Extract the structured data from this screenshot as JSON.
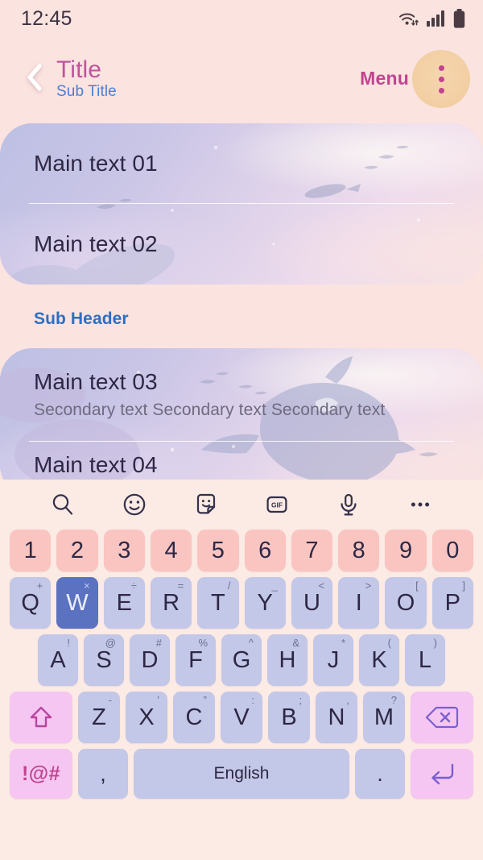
{
  "colors": {
    "page_background": "#fbe3e0",
    "title": "#c0539c",
    "subtitle": "#4a7fd4",
    "sub_header": "#2d6fc4",
    "menu_label": "#c0448f",
    "more_circle": "#f3cfa4",
    "keyboard_background": "#fceae4",
    "number_key": "#fac5c1",
    "letter_key": "#c3c7e8",
    "pressed_key": "#5b72c0",
    "function_key_pink": "#f6c6f2",
    "main_text": "#2e2744",
    "secondary_text": "#6f6a80"
  },
  "status_bar": {
    "time": "12:45",
    "icons": [
      "wifi-icon",
      "signal-icon",
      "battery-icon"
    ]
  },
  "app_bar": {
    "back_icon": "chevron-left-icon",
    "title": "Title",
    "subtitle": "Sub Title",
    "menu_label": "Menu",
    "more_icon": "more-vertical-icon"
  },
  "content": {
    "card_a": {
      "rows": [
        {
          "main": "Main text 01"
        },
        {
          "main": "Main text 02"
        }
      ]
    },
    "sub_header": "Sub Header",
    "card_b": {
      "rows": [
        {
          "main": "Main text 03",
          "secondary": "Secondary text Secondary text Secondary text"
        },
        {
          "main": "Main text 04"
        }
      ]
    }
  },
  "keyboard": {
    "toolbar": [
      {
        "name": "search-icon",
        "label": "search"
      },
      {
        "name": "emoji-icon",
        "label": "emoji"
      },
      {
        "name": "sticker-icon",
        "label": "sticker"
      },
      {
        "name": "gif-icon",
        "label": "GIF"
      },
      {
        "name": "mic-icon",
        "label": "voice"
      },
      {
        "name": "more-icon",
        "label": "more"
      }
    ],
    "number_row": [
      "1",
      "2",
      "3",
      "4",
      "5",
      "6",
      "7",
      "8",
      "9",
      "0"
    ],
    "row1": [
      {
        "key": "Q",
        "sup": "+"
      },
      {
        "key": "W",
        "sup": "×",
        "pressed": true
      },
      {
        "key": "E",
        "sup": "÷"
      },
      {
        "key": "R",
        "sup": "="
      },
      {
        "key": "T",
        "sup": "/"
      },
      {
        "key": "Y",
        "sup": "_"
      },
      {
        "key": "U",
        "sup": "<"
      },
      {
        "key": "I",
        "sup": ">"
      },
      {
        "key": "O",
        "sup": "["
      },
      {
        "key": "P",
        "sup": "]"
      }
    ],
    "row2": [
      {
        "key": "A",
        "sup": "!"
      },
      {
        "key": "S",
        "sup": "@"
      },
      {
        "key": "D",
        "sup": "#"
      },
      {
        "key": "F",
        "sup": "%"
      },
      {
        "key": "G",
        "sup": "^"
      },
      {
        "key": "H",
        "sup": "&"
      },
      {
        "key": "J",
        "sup": "*"
      },
      {
        "key": "K",
        "sup": "("
      },
      {
        "key": "L",
        "sup": ")"
      }
    ],
    "row3": {
      "shift_icon": "shift-up-arrow-icon",
      "keys": [
        {
          "key": "Z",
          "sup": "-"
        },
        {
          "key": "X",
          "sup": "’"
        },
        {
          "key": "C",
          "sup": "”"
        },
        {
          "key": "V",
          "sup": ":"
        },
        {
          "key": "B",
          "sup": ";"
        },
        {
          "key": "N",
          "sup": ","
        },
        {
          "key": "M",
          "sup": "?"
        }
      ],
      "backspace_icon": "backspace-icon"
    },
    "row4": {
      "symbols_label": "!@#",
      "comma_label": ",",
      "space_label": "English",
      "period_label": ".",
      "enter_icon": "enter-return-icon"
    }
  }
}
